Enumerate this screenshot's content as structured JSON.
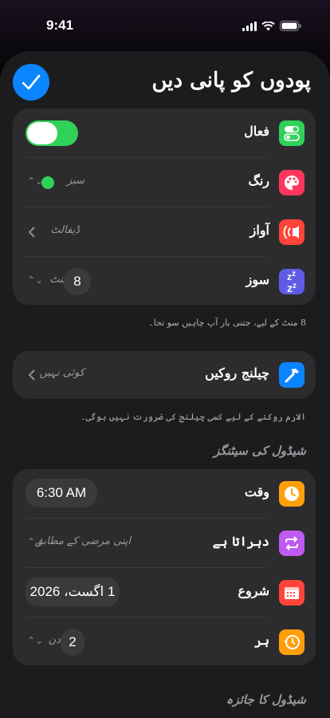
{
  "status": {
    "time": "9:41"
  },
  "header": {
    "title": "پودوں کو پانی دیں"
  },
  "settings": {
    "active_label": "فعال",
    "color_label": "رنگ",
    "color_value": "سبز",
    "color_dot": "#30d158",
    "sound_label": "آواز",
    "sound_value": "ڈیفالٹ",
    "snooze_label": "سوز",
    "snooze_number": "8",
    "snooze_unit": "منٹ"
  },
  "snooze_footer": "8 منٹ کے لیے، جتنی بار آپ چاہیں سو تحا۔",
  "challenge": {
    "label": "چیلنج روکیں",
    "value": "کوئی نہیں"
  },
  "challenge_footer": "الارم روکنے کے لیے کسی چیلنج کی ضرورت نہیں ہوگی۔",
  "schedule": {
    "section_title": "شیڈول کی سیٹنگز",
    "time_label": "وقت",
    "time_value": "6:30 AM",
    "repeat_label": "دہراتا ہے",
    "repeat_value": "اپنی مرضی کے مطابق",
    "start_label": "شروع",
    "start_value": "1 اگست، 2026",
    "every_label": "ہر",
    "every_number": "2",
    "every_unit": "دن"
  },
  "review_title": "شیڈول کا جائزہ",
  "colors": {
    "accent": "#0a84ff",
    "toggle_on": "#30d158"
  }
}
